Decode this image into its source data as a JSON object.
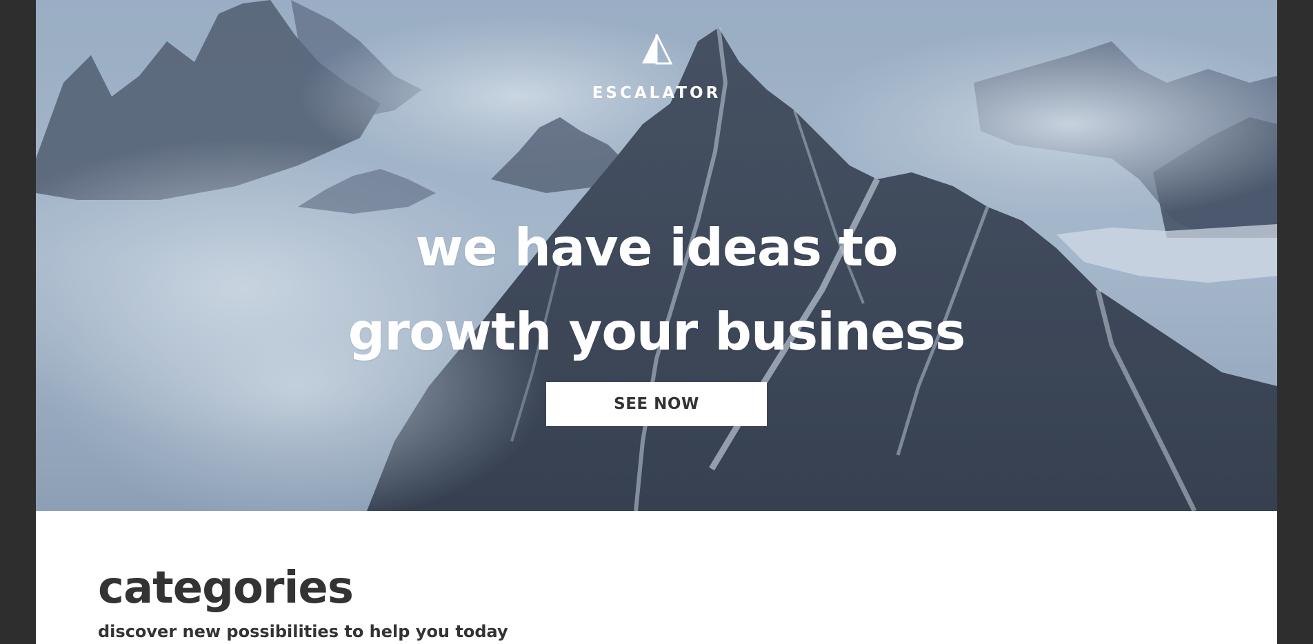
{
  "hero": {
    "logo_text": "ESCALATOR",
    "headline_line1": "we have ideas to",
    "headline_line2": "growth your business",
    "cta_label": "SEE NOW"
  },
  "categories": {
    "title": "categories",
    "subtitle": "discover new possibilities to help you today"
  },
  "icons": {
    "logo": "triangle-logo-icon"
  },
  "colors": {
    "frame": "#2e2e2e",
    "hero_tint": "#8ea1b8",
    "text_dark": "#333333",
    "white": "#ffffff"
  }
}
